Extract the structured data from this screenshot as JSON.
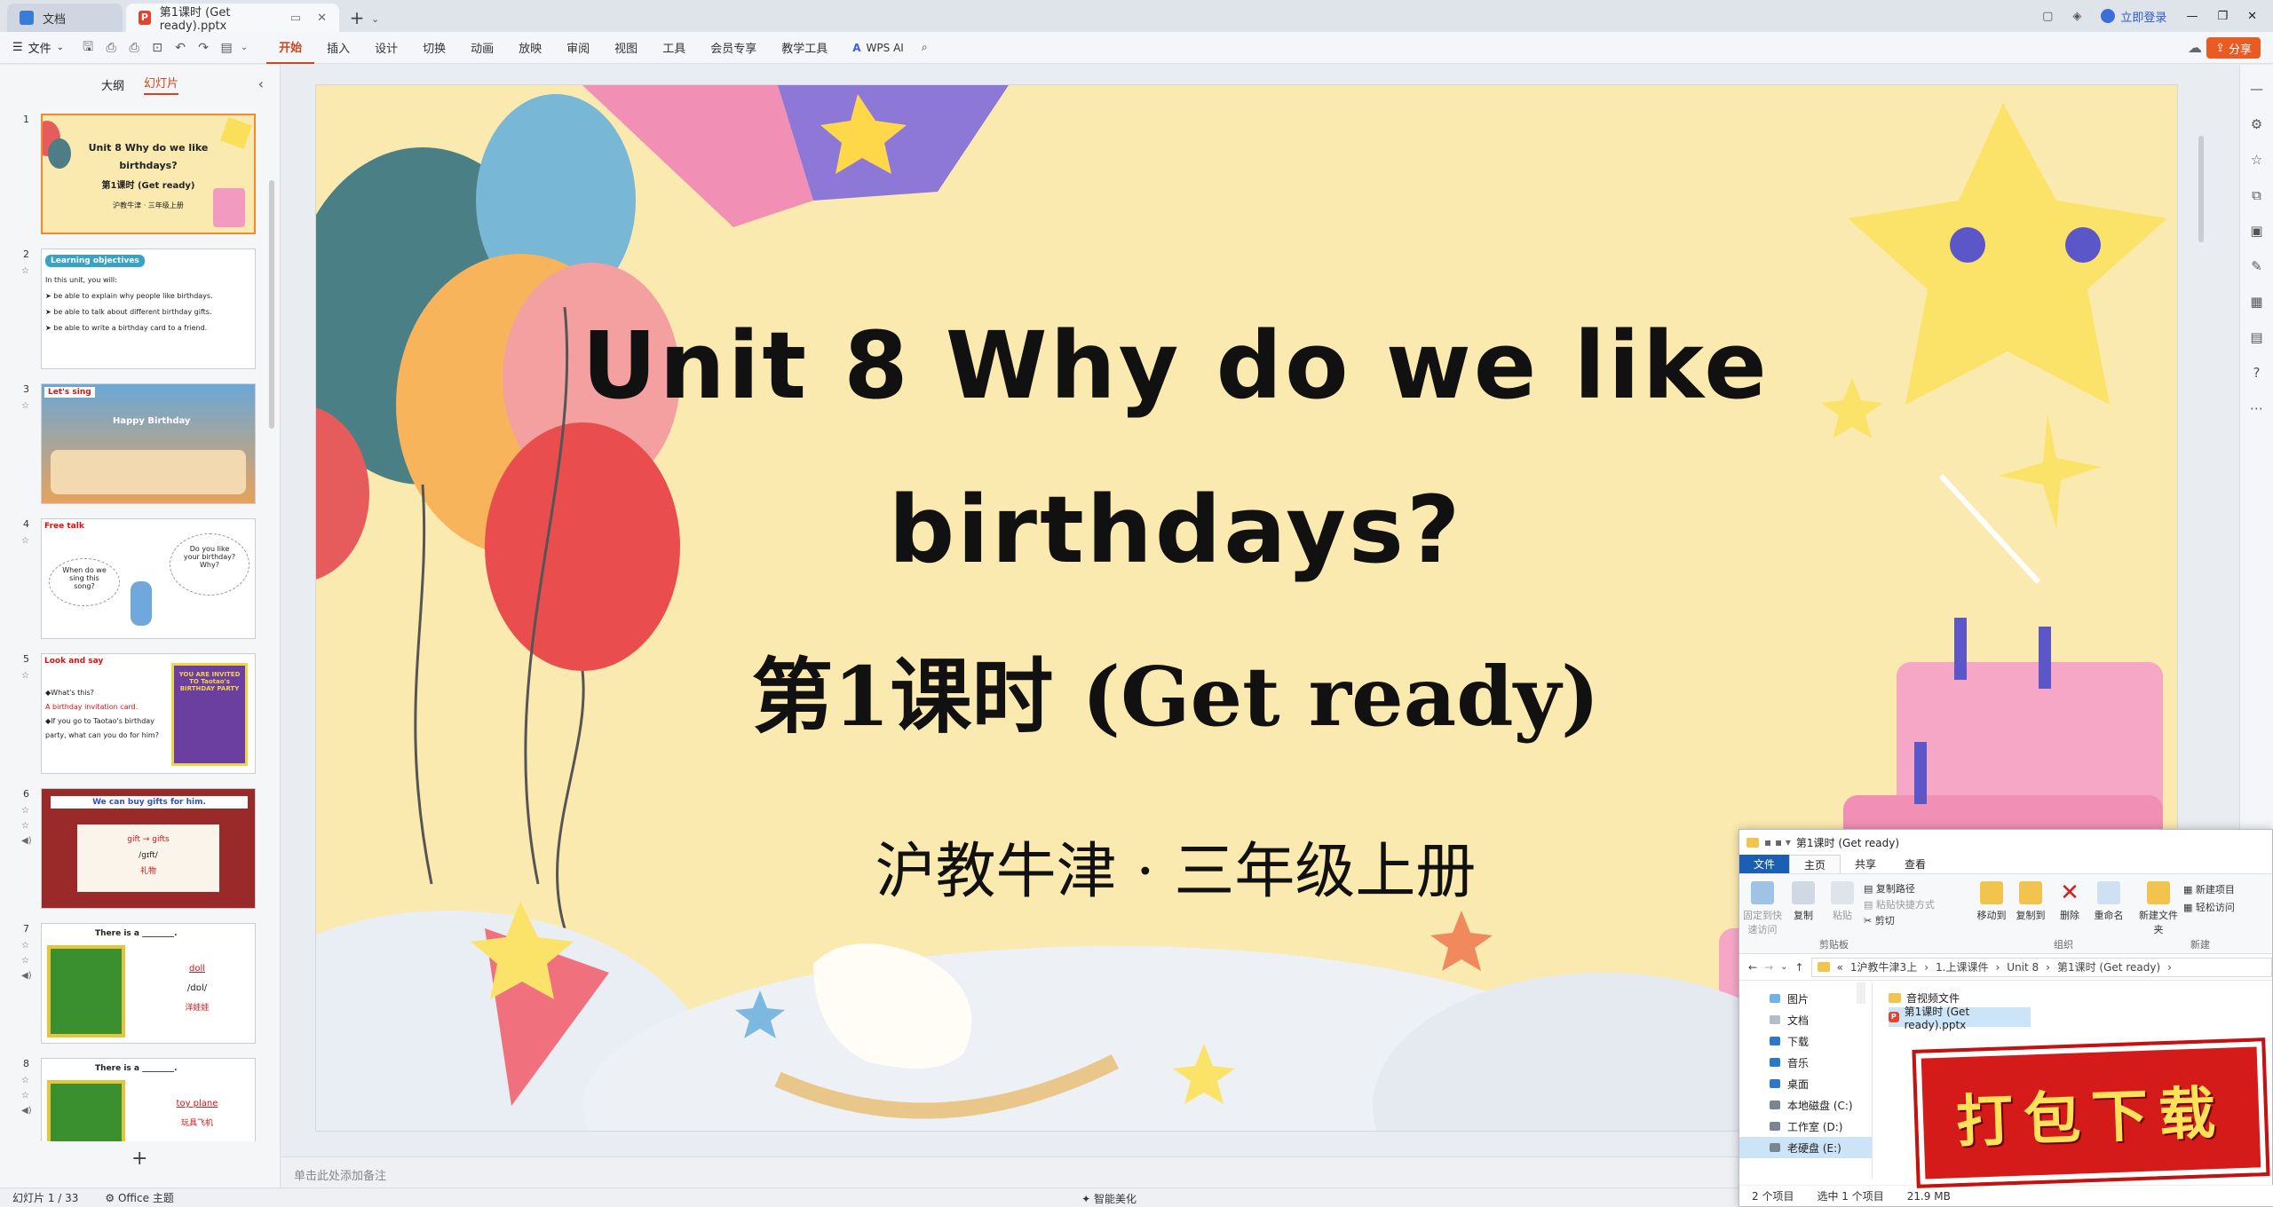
{
  "titlebar": {
    "tabs": [
      {
        "label": "文档",
        "icon": "wps-docs-icon"
      },
      {
        "label": "第1课时 (Get ready).pptx",
        "icon": "pptx-file-icon"
      }
    ],
    "new_tab": "+",
    "login": "立即登录"
  },
  "ribbon": {
    "file_menu": "文件",
    "menus": [
      "开始",
      "插入",
      "设计",
      "切换",
      "动画",
      "放映",
      "审阅",
      "视图",
      "工具",
      "会员专享",
      "教学工具"
    ],
    "active_menu": "开始",
    "wps_ai": "WPS AI",
    "share": "分享"
  },
  "leftpane": {
    "tabs": [
      "大纲",
      "幻灯片"
    ],
    "active_tab": "幻灯片",
    "thumbnails": [
      {
        "num": "1",
        "lines": [
          "Unit 8 Why do we like",
          "birthdays?",
          "第1课时 (Get ready)",
          "沪教牛津 · 三年级上册"
        ]
      },
      {
        "num": "2",
        "heading": "Learning objectives",
        "lines": [
          "In this unit, you will:",
          "➤ be able to explain why people like birthdays.",
          "➤ be able to talk about different birthday gifts.",
          "➤ be able to write a birthday card to a friend."
        ]
      },
      {
        "num": "3",
        "heading": "Let's sing",
        "lines": [
          "Happy Birthday"
        ]
      },
      {
        "num": "4",
        "heading": "Free talk",
        "lines": [
          "When do we sing this song?",
          "Do you like your birthday? Why?"
        ]
      },
      {
        "num": "5",
        "heading": "Look and say",
        "lines": [
          "◆What's this?",
          "A birthday invitation card.",
          "◆If you go to Taotao's birthday party, what can you do for him?",
          "YOU ARE INVITED TO Taotao's BIRTHDAY PARTY"
        ]
      },
      {
        "num": "6",
        "heading": "We can buy gifts for him.",
        "lines": [
          "gift → gifts",
          "/gɪft/",
          "礼物"
        ]
      },
      {
        "num": "7",
        "heading": "There is a ________.",
        "lines": [
          "doll",
          "/dɒl/",
          "洋娃娃"
        ]
      },
      {
        "num": "8",
        "heading": "There is a ________.",
        "lines": [
          "toy plane",
          "玩具飞机"
        ]
      }
    ],
    "add_slide": "+"
  },
  "slide": {
    "title_line1": "Unit 8 Why do we like",
    "title_line2": "birthdays?",
    "subtitle": "第1课时 (Get ready)",
    "publisher": "沪教牛津 · 三年级上册"
  },
  "notes_placeholder": "单击此处添加备注",
  "statusbar": {
    "slide_counter": "幻灯片 1 / 33",
    "theme": "Office 主题",
    "beautify": "智能美化"
  },
  "explorer": {
    "title": "第1课时 (Get ready)",
    "tabs": [
      "文件",
      "主页",
      "共享",
      "查看"
    ],
    "ribbon_buttons": [
      {
        "label": "固定到快速访问"
      },
      {
        "label": "复制"
      },
      {
        "label": "粘贴"
      },
      {
        "label": "复制路径"
      },
      {
        "label": "粘贴快捷方式"
      },
      {
        "label": "剪切"
      },
      {
        "label": "移动到"
      },
      {
        "label": "复制到"
      },
      {
        "label": "删除"
      },
      {
        "label": "重命名"
      },
      {
        "label": "新建文件夹"
      },
      {
        "label": "新建项目"
      },
      {
        "label": "轻松访问"
      }
    ],
    "groups": [
      "剪贴板",
      "组织",
      "新建"
    ],
    "breadcrumb": [
      "«",
      "1沪教牛津3上",
      "1.上课课件",
      "Unit 8",
      "第1课时 (Get ready)"
    ],
    "nav_items": [
      "图片",
      "文档",
      "下载",
      "音乐",
      "桌面",
      "本地磁盘 (C:)",
      "工作室 (D:)",
      "老硬盘 (E:)"
    ],
    "files": [
      "音视频文件",
      "第1课时 (Get ready).pptx"
    ],
    "status": {
      "count": "2 个项目",
      "selected": "选中 1 个项目",
      "size": "21.9 MB"
    }
  },
  "badge": {
    "text": "打包下载"
  },
  "colors": {
    "accent": "#d0451b",
    "share_bg": "#ea5a23",
    "slide_bg": "#fbeab0",
    "badge_red": "#d51a1a",
    "badge_text": "#ffe25a"
  }
}
